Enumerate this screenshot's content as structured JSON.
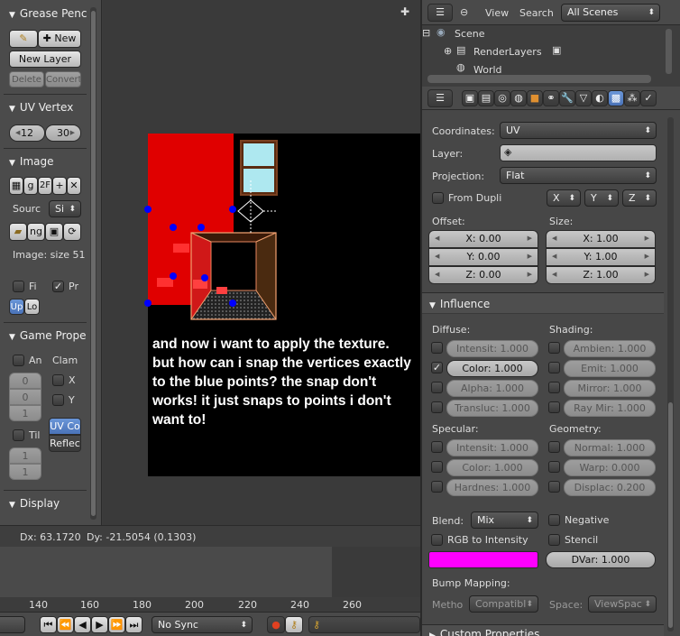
{
  "toolshelf": {
    "grease_pencil": {
      "title": "Grease Penc",
      "new_label": "New",
      "new_layer_label": "New Layer",
      "delete_label": "Delete",
      "convert_label": "Convert"
    },
    "uv_vertex": {
      "title": "UV Vertex",
      "x": "12",
      "y": "30"
    },
    "image": {
      "title": "Image",
      "slot_g": "g",
      "slot_2f": "2F",
      "source_label": "Sourc",
      "source_value": "Si",
      "file_short": "ng",
      "size_label": "Image: size 51",
      "fi_label": "Fi",
      "pr_label": "Pr",
      "up_label": "Up",
      "lo_label": "Lo"
    },
    "game_props": {
      "title": "Game Prope",
      "an_label": "An",
      "clamp_label": "Clam",
      "x_label": "X",
      "y_label": "Y",
      "v0": "0",
      "v1": "0",
      "v2": "1",
      "til_label": "Til",
      "t0": "1",
      "t1": "1",
      "uvco_label": "UV Co",
      "reflec_label": "Reflec"
    },
    "display": {
      "title": "Display"
    }
  },
  "viewport": {
    "overlay_text": "and now i want to apply the texture. but how can i snap the vertices exactly to the blue points? the snap don't works! it just snaps to points i don't want to!",
    "status": {
      "dx": "Dx: 63.1720",
      "dy": "Dy: -21.5054 (0.1303)"
    }
  },
  "timeline": {
    "ticks": [
      "140",
      "160",
      "180",
      "200",
      "220",
      "240",
      "260"
    ],
    "sync": "No Sync"
  },
  "outliner": {
    "view": "View",
    "search": "Search",
    "filter": "All Scenes",
    "items": [
      "Scene",
      "RenderLayers",
      "World"
    ]
  },
  "properties": {
    "coordinates_label": "Coordinates:",
    "coordinates_value": "UV",
    "layer_label": "Layer:",
    "projection_label": "Projection:",
    "projection_value": "Flat",
    "from_dupli": "From Dupli",
    "px": "X",
    "py": "Y",
    "pz": "Z",
    "offset_label": "Offset:",
    "size_label": "Size:",
    "offset": [
      "X: 0.00",
      "Y: 0.00",
      "Z: 0.00"
    ],
    "size": [
      "X: 1.00",
      "Y: 1.00",
      "Z: 1.00"
    ],
    "influence_title": "Influence",
    "diffuse_label": "Diffuse:",
    "shading_label": "Shading:",
    "diffuse": [
      "Intensit: 1.000",
      "Color: 1.000",
      "Alpha: 1.000",
      "Transluc: 1.000"
    ],
    "shading": [
      "Ambien: 1.000",
      "Emit: 1.000",
      "Mirror: 1.000",
      "Ray Mir: 1.000"
    ],
    "specular_label": "Specular:",
    "geometry_label": "Geometry:",
    "specular": [
      "Intensit: 1.000",
      "Color: 1.000",
      "Hardnes: 1.000"
    ],
    "geometry": [
      "Normal: 1.000",
      "Warp: 0.000",
      "Displac: 0.200"
    ],
    "blend_label": "Blend:",
    "blend_value": "Mix",
    "negative": "Negative",
    "rgb_to_intensity": "RGB to Intensity",
    "stencil": "Stencil",
    "color_swatch": "#ff00ff",
    "dvar": "DVar: 1.000",
    "bump_label": "Bump Mapping:",
    "method_label": "Metho",
    "method_value": "Compatibl",
    "space_label": "Space:",
    "space_value": "ViewSpac",
    "custom_props": "Custom Properties"
  }
}
